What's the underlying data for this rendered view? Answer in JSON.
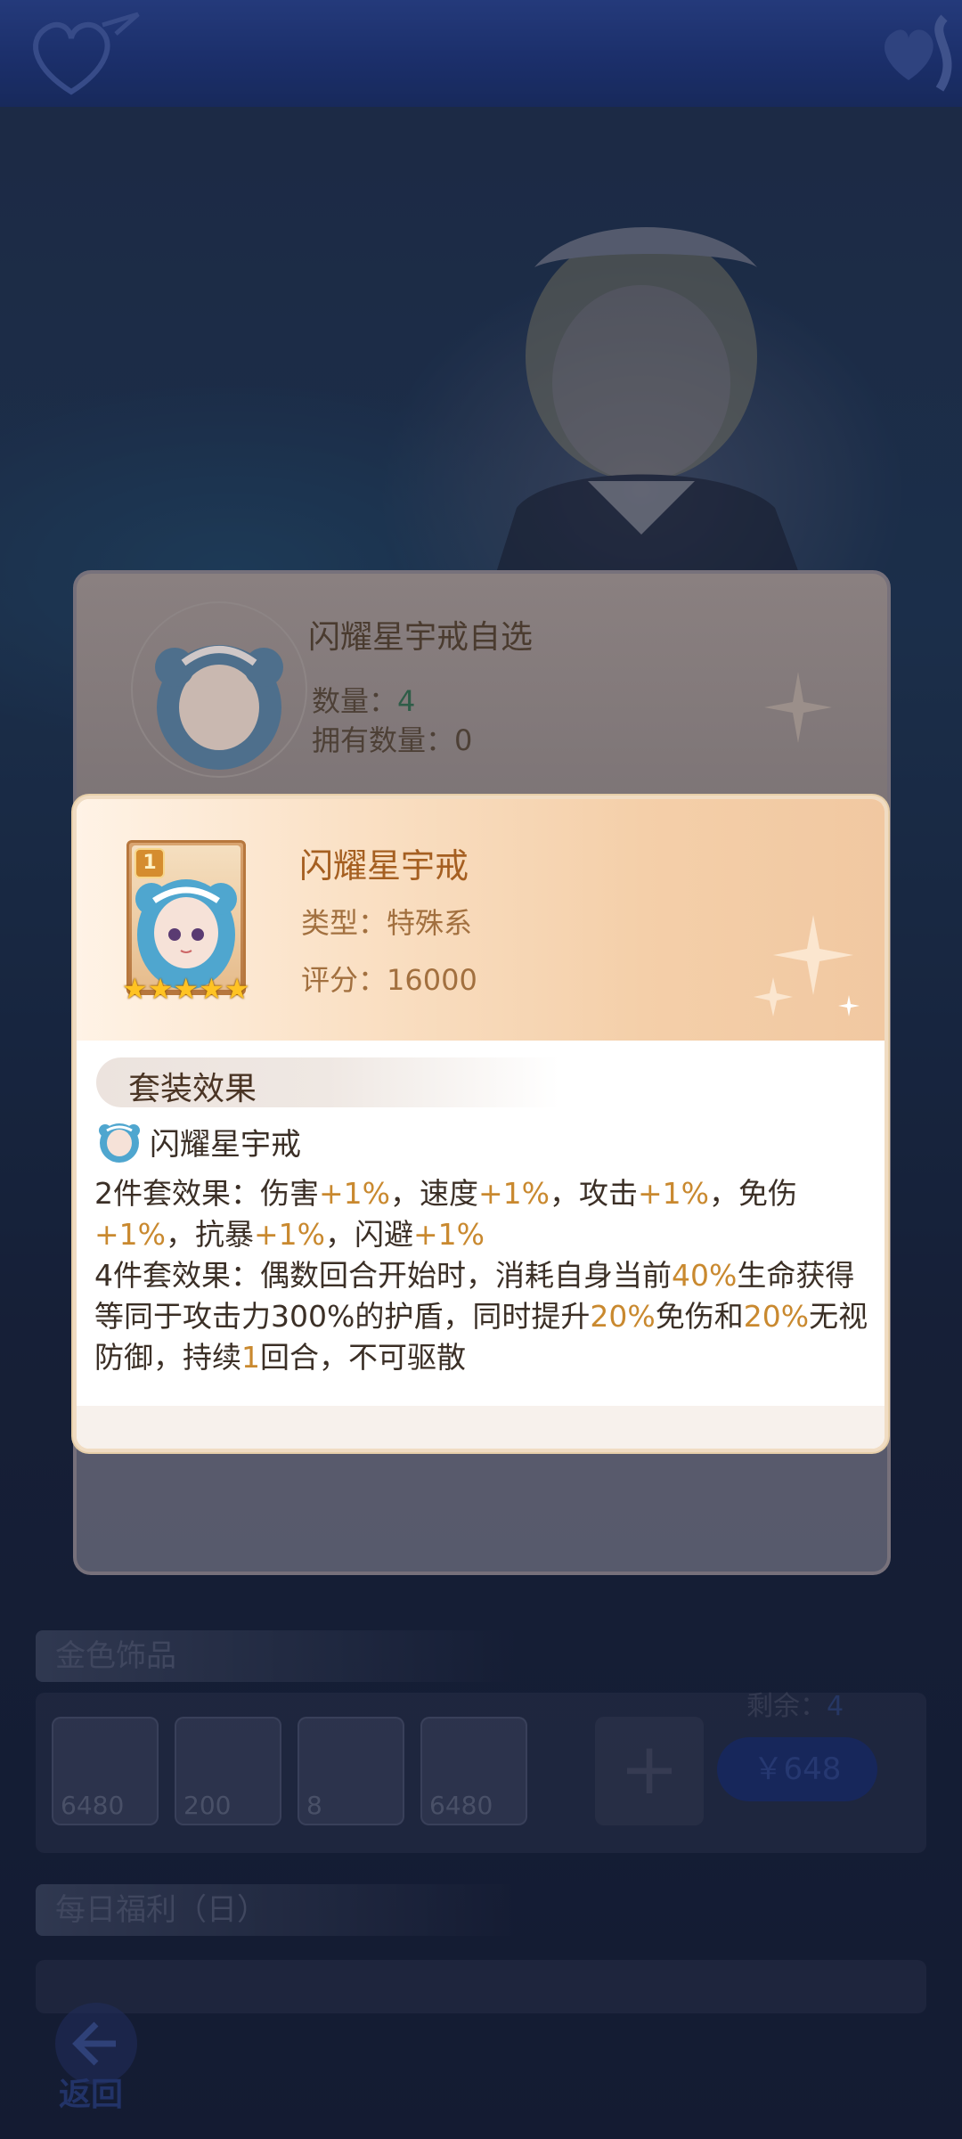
{
  "background": {
    "section_gold_title": "金色饰品",
    "section_daily_title": "每日福利（日）",
    "gold_items": [
      {
        "count": "6480"
      },
      {
        "count": "200"
      },
      {
        "count": "8"
      },
      {
        "count": "6480"
      }
    ],
    "remain_label": "剩余：",
    "remain_value": "4",
    "price_button": "￥648",
    "back_label": "返回"
  },
  "outer_dialog": {
    "title": "闪耀星宇戒自选",
    "qty_label": "数量：",
    "qty_value": "4",
    "owned_label": "拥有数量：",
    "owned_value": "0"
  },
  "item_card": {
    "level": "1",
    "stars": 5,
    "name": "闪耀星宇戒",
    "type_label": "类型：",
    "type_value": "特殊系",
    "score_label": "评分：",
    "score_value": "16000",
    "set_section_title": "套装效果",
    "set_name": "闪耀星宇戒",
    "two_piece": {
      "prefix": "2件套效果：",
      "parts": [
        {
          "t": "伤害",
          "v": "+1%",
          "sep": "，"
        },
        {
          "t": "速度",
          "v": "+1%",
          "sep": "，"
        },
        {
          "t": "攻击",
          "v": "+1%",
          "sep": "，"
        },
        {
          "t": "免伤",
          "v": "+1%",
          "sep": "，"
        },
        {
          "t": "抗暴",
          "v": "+1%",
          "sep": "，"
        },
        {
          "t": "闪避",
          "v": "+1%",
          "sep": ""
        }
      ]
    },
    "four_piece": {
      "prefix": "4件套效果：",
      "text1": "偶数回合开始时，消耗自身当前",
      "v1": "40%",
      "text2": "生命获得等同于攻击力300%的护盾，同时提升",
      "v2": "20%",
      "text3": "免伤和",
      "v3": "20%",
      "text4": "无视防御，持续",
      "v4": "1",
      "text5": "回合，不可驱散"
    }
  },
  "colors": {
    "topbar": "#284aa8",
    "card_name": "#a55f21",
    "highlight": "#c9892f",
    "star": "#ffc323"
  }
}
